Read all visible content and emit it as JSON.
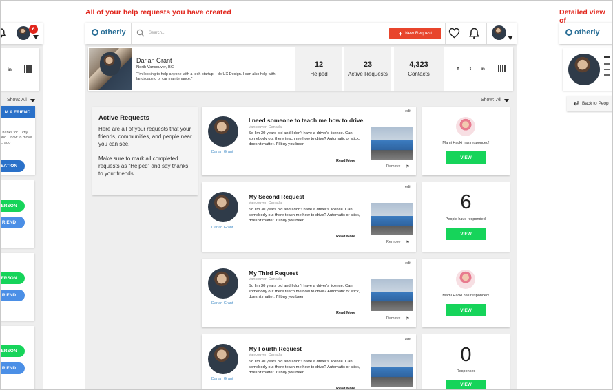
{
  "titles": {
    "center": "All of your help requests you have created",
    "right": "Detailed view of"
  },
  "header": {
    "logo_text": "otherly",
    "search_placeholder": "Search...",
    "new_request_label": "New Request",
    "notification_count": "6"
  },
  "profile": {
    "name": "Darian Grant",
    "location": "North Vancouver, BC",
    "bio": "“I'm looking to help anyone with a tech startup. I do UX Design. I can also help with landscaping or car maintenance.”",
    "stats": [
      {
        "value": "12",
        "label": "Helped"
      },
      {
        "value": "23",
        "label": "Active Requests"
      },
      {
        "value": "4,323",
        "label": "Contacts"
      }
    ]
  },
  "filter": {
    "label": "Show:",
    "value": "All"
  },
  "info": {
    "title": "Active Requests",
    "p1": "Here are all of your requests that your friends, communities, and people near you can see.",
    "p2": "Make sure to mark all completed requests as “Helped” and say thanks to your friends."
  },
  "request_common": {
    "author": "Darian Grant",
    "location": "Vancouver, Canada",
    "body": "So I'm 30 years old and I don't have a driver's licence.  Can somebody out there teach me how to drive? Automatic or stick, doesn't matter.  I'll buy you beer.",
    "read_more": "Read More",
    "remove": "Remove",
    "edit": "edit",
    "view": "VIEW"
  },
  "requests": [
    {
      "title": "I need someone to teach me how to drive.",
      "response_text": "Mami Hacki has responded!"
    },
    {
      "title": "My Second Request",
      "response_count": "6",
      "response_text": "People have responded!"
    },
    {
      "title": "My Third Request",
      "response_text": "Mami Hacki has responded!"
    },
    {
      "title": "My Fourth Request",
      "response_count": "0",
      "response_text": "Responses"
    }
  ],
  "left_panel": {
    "filter_label": "Show:",
    "filter_value": "All",
    "top_button": "M A FRIEND",
    "snippet": "Thanks for ...ctly and ...how to move ... ago",
    "conversation_button": "SATION",
    "person_button": "ERSON",
    "friend_button": "RIEND"
  },
  "right_panel": {
    "logo_text": "otherly",
    "back_label": "Back to Peop"
  },
  "social": [
    "f",
    "t",
    "in"
  ]
}
